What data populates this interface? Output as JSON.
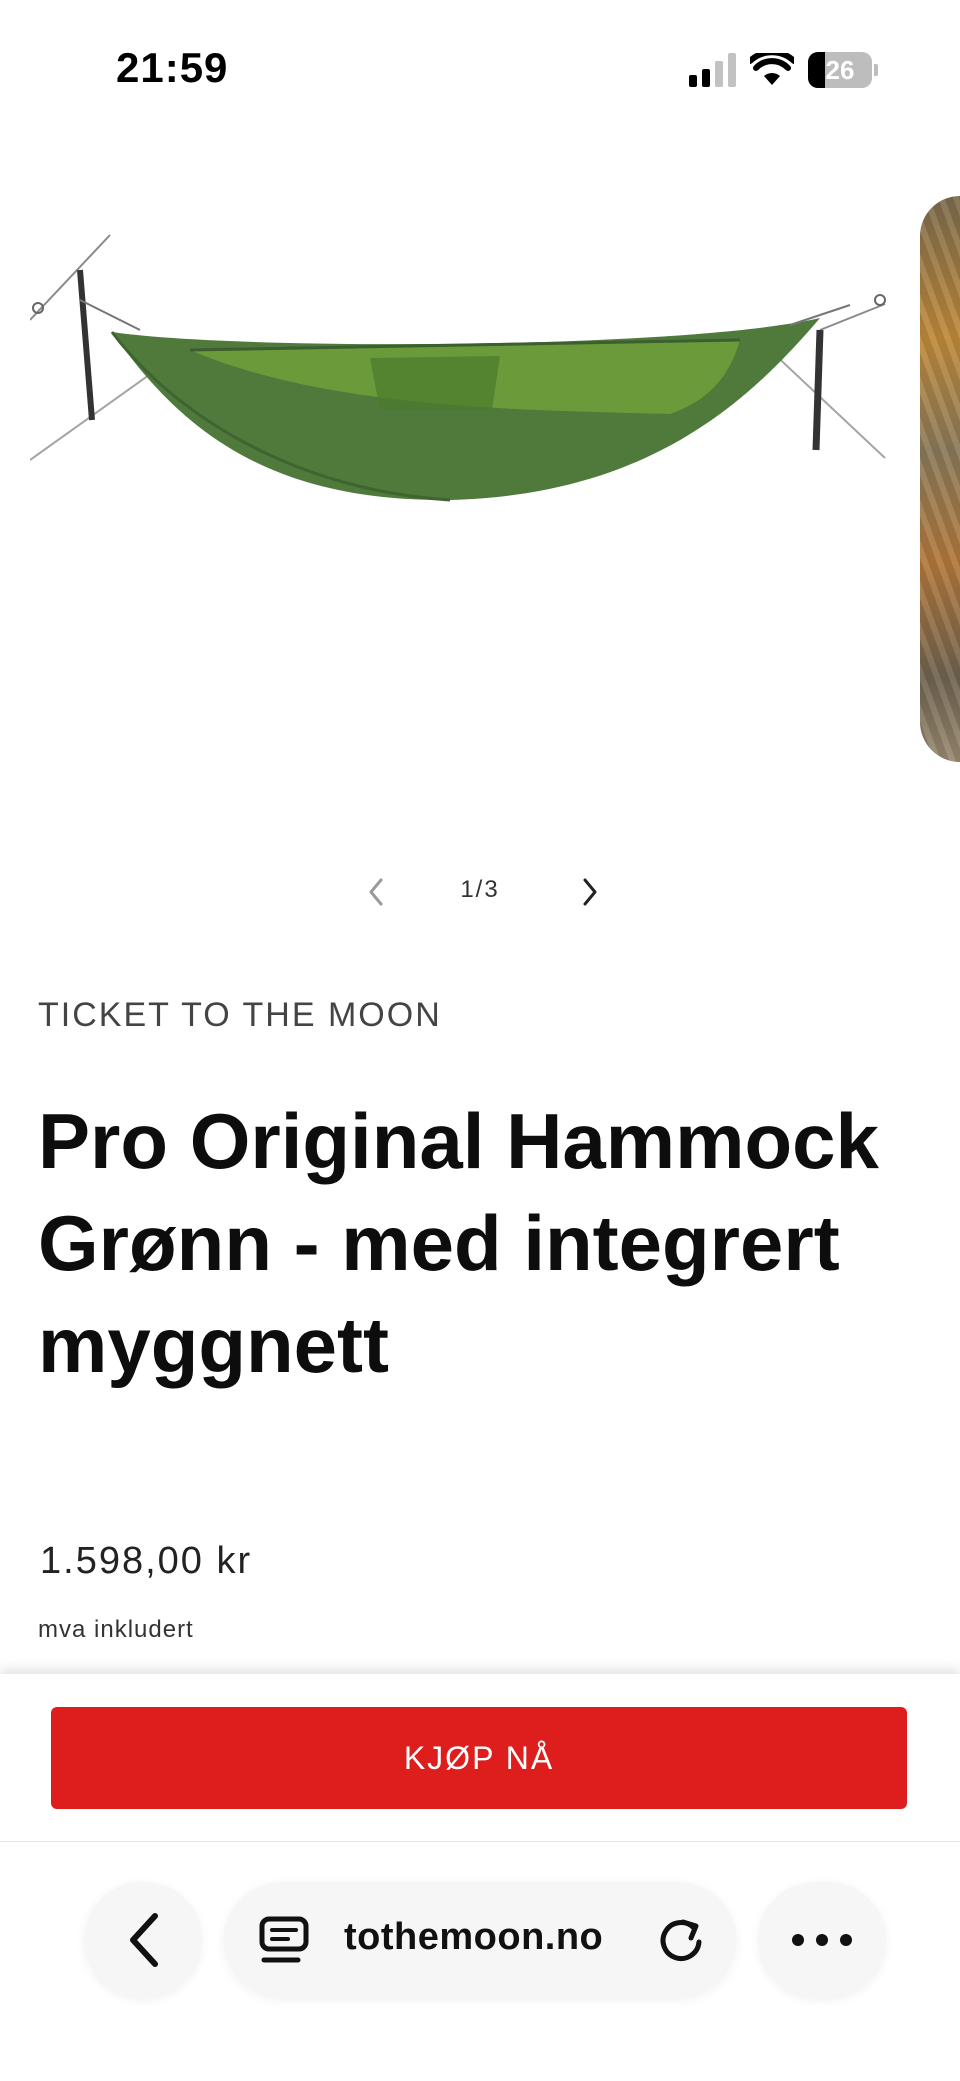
{
  "status_bar": {
    "time": "21:59",
    "battery": "26"
  },
  "gallery": {
    "counter": "1/3",
    "current_image": "green-hammock-image",
    "next_image": "forest-hammock-image",
    "hammock_color": "#4f7a3c"
  },
  "product": {
    "vendor": "TICKET TO THE MOON",
    "title": "Pro Original Hammock Grønn - med integrert myggnett",
    "price": "1.598,00 kr",
    "tax_note": "mva inkludert"
  },
  "buy_bar": {
    "button_label": "KJØP NÅ",
    "button_color": "#de1d1d"
  },
  "browser": {
    "domain": "tothemoon.no",
    "back_icon": "chevron-left-icon",
    "page_icon": "page-menu-icon",
    "reload_icon": "reload-icon",
    "more_icon": "more-icon"
  }
}
